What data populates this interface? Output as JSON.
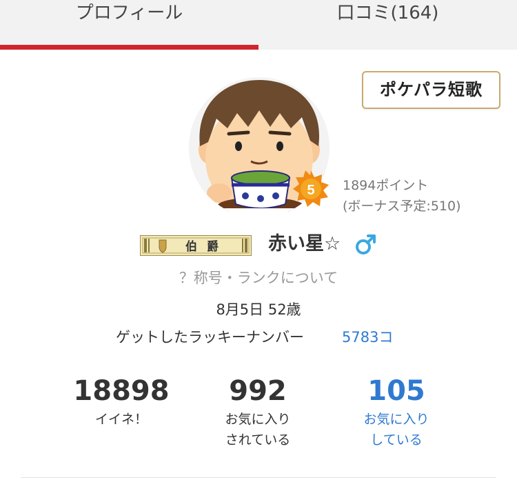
{
  "tabs": [
    {
      "label": "プロフィール",
      "active": true
    },
    {
      "label": "口コミ(164)",
      "active": false
    }
  ],
  "accent_color": "#d0262b",
  "link_color": "#2f7ad0",
  "tanka_button": {
    "label": "ポケパラ短歌"
  },
  "profile": {
    "avatar_icon": "avatar-drinking-tea",
    "rank_badge": {
      "level": "5",
      "icon": "star-badge-icon"
    },
    "points": "1894ポイント",
    "bonus": "(ボーナス予定:510)",
    "title_plate": {
      "text": "伯爵",
      "icon": "shield-icon"
    },
    "username": "赤い星☆",
    "gender_icon": "male-symbol-icon",
    "rank_info_link": "？称号・ランクについて",
    "birthday": "8月5日 52歳",
    "lucky_number_label": "ゲットしたラッキーナンバー",
    "lucky_number_value": "5783コ"
  },
  "stats": [
    {
      "value": "18898",
      "label_line1": "イイネ！",
      "label_line2": ""
    },
    {
      "value": "992",
      "label_line1": "お気に入り",
      "label_line2": "されている"
    },
    {
      "value": "105",
      "label_line1": "お気に入り",
      "label_line2": "している"
    }
  ]
}
